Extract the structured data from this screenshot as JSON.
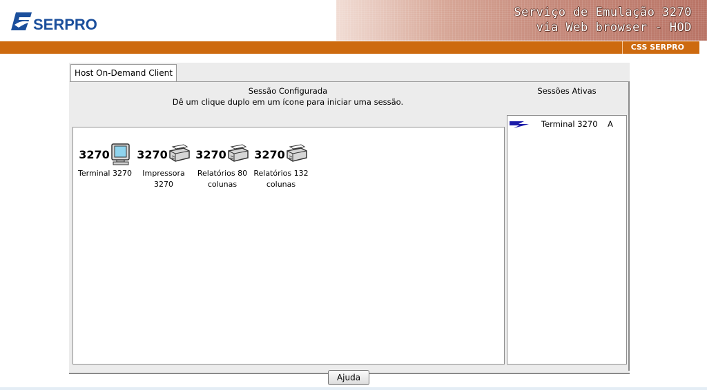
{
  "header": {
    "logo_text": "SERPRO",
    "banner_line1": "Serviço de Emulação 3270",
    "banner_line2": "via Web browser - HOD",
    "org_label": "CSS SERPRO"
  },
  "applet": {
    "tab_label": "Host On-Demand Client",
    "configured": {
      "title": "Sessão Configurada",
      "instruction": "Dê um clique duplo em um ícone para iniciar uma sessão.",
      "sessions": [
        {
          "number": "3270",
          "icon": "monitor-icon",
          "label_line1": "Terminal 3270",
          "label_line2": ""
        },
        {
          "number": "3270",
          "icon": "printer-icon",
          "label_line1": "Impressora",
          "label_line2": "3270"
        },
        {
          "number": "3270",
          "icon": "printer-icon",
          "label_line1": "Relatórios 80",
          "label_line2": "colunas"
        },
        {
          "number": "3270",
          "icon": "printer-icon",
          "label_line1": "Relatórios 132",
          "label_line2": "colunas"
        }
      ]
    },
    "active": {
      "title": "Sessões Ativas",
      "sessions": [
        {
          "icon": "lightning-icon",
          "name": "Terminal 3270",
          "id": "A"
        }
      ]
    },
    "help_button": "Ajuda"
  },
  "colors": {
    "brand_blue": "#1b4f9c",
    "orange_bar": "#cd6a0f",
    "active_icon": "#1a1aa8"
  }
}
